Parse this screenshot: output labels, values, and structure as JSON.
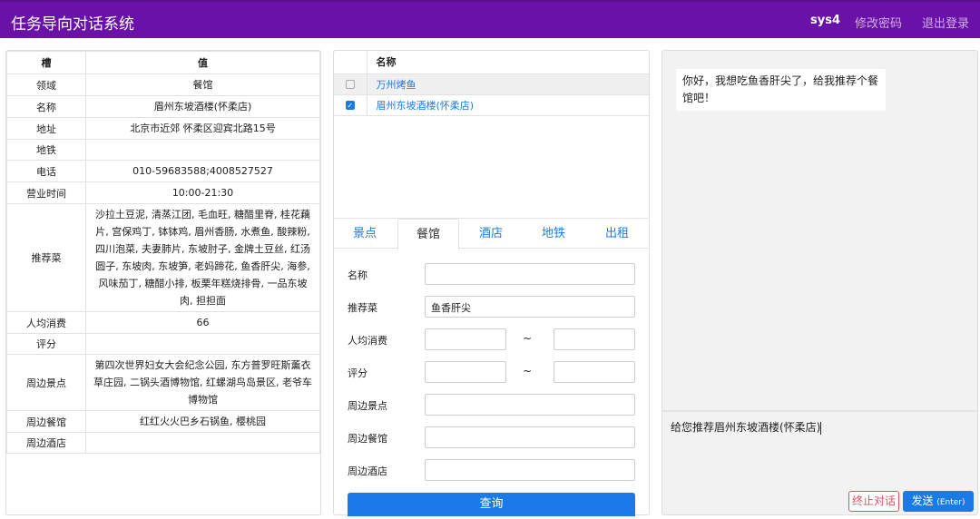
{
  "header": {
    "title": "任务导向对话系统",
    "user": "sys4",
    "change_password": "修改密码",
    "logout": "退出登录"
  },
  "slots": {
    "col_slot": "槽",
    "col_value": "值",
    "rows": [
      {
        "k": "领域",
        "v": "餐馆"
      },
      {
        "k": "名称",
        "v": "眉州东坡酒楼(怀柔店)"
      },
      {
        "k": "地址",
        "v": "北京市近郊 怀柔区迎宾北路15号"
      },
      {
        "k": "地铁",
        "v": ""
      },
      {
        "k": "电话",
        "v": "010-59683588;4008527527"
      },
      {
        "k": "营业时间",
        "v": "10:00-21:30"
      },
      {
        "k": "推荐菜",
        "v": "沙拉土豆泥, 清蒸江团, 毛血旺, 糖醋里脊, 桂花藕片, 宫保鸡丁, 钵钵鸡, 眉州香肠, 水煮鱼, 酸辣粉, 四川泡菜, 夫妻肺片, 东坡肘子, 金牌土豆丝, 红汤圆子, 东坡肉, 东坡笋, 老妈蹄花, 鱼香肝尖, 海参, 风味茄丁, 糖醋小排, 板栗年糕烧排骨, 一品东坡肉, 担担面"
      },
      {
        "k": "人均消费",
        "v": "66"
      },
      {
        "k": "评分",
        "v": ""
      },
      {
        "k": "周边景点",
        "v": "第四次世界妇女大会纪念公园, 东方普罗旺斯薰衣草庄园, 二锅头酒博物馆, 红螺湖鸟岛景区, 老爷车博物馆"
      },
      {
        "k": "周边餐馆",
        "v": "红红火火巴乡石锅鱼, 樱桃园"
      },
      {
        "k": "周边酒店",
        "v": ""
      }
    ]
  },
  "results": {
    "col_name": "名称",
    "items": [
      {
        "name": "万州烤鱼",
        "checked": false
      },
      {
        "name": "眉州东坡酒楼(怀柔店)",
        "checked": true
      }
    ]
  },
  "tabs": [
    {
      "label": "景点"
    },
    {
      "label": "餐馆",
      "active": true
    },
    {
      "label": "酒店"
    },
    {
      "label": "地铁"
    },
    {
      "label": "出租"
    }
  ],
  "form": {
    "name": "名称",
    "dish": "推荐菜",
    "dish_value": "鱼香肝尖",
    "price": "人均消费",
    "rating": "评分",
    "tilde": "~",
    "near_spot": "周边景点",
    "near_rest": "周边餐馆",
    "near_hotel": "周边酒店",
    "query": "查询"
  },
  "chat": {
    "user_message": "你好，我想吃鱼香肝尖了，给我推荐个餐馆吧！",
    "reply_draft": "给您推荐眉州东坡酒楼(怀柔店)",
    "stop": "终止对话",
    "send": "发送",
    "send_hint": "(Enter)"
  },
  "colors": {
    "header": "#6a11a8",
    "accent": "#1a7be8",
    "danger": "#e05060"
  }
}
